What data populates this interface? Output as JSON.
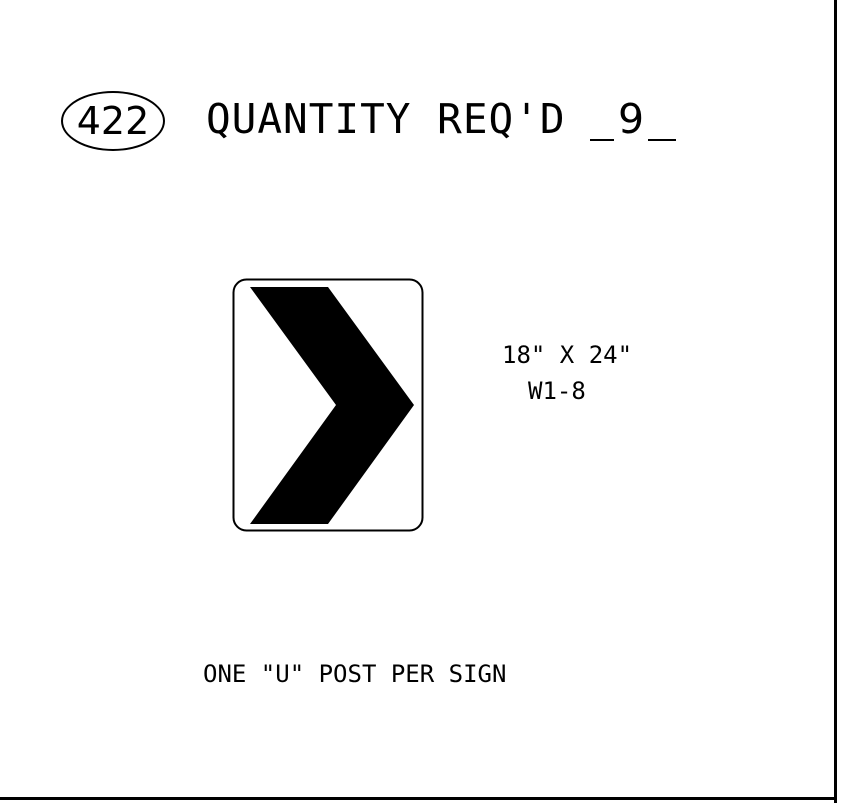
{
  "sheet": {
    "item_number": "422",
    "quantity_label": "QUANTITY REQ'D",
    "quantity_value": "9"
  },
  "sign": {
    "symbol": "chevron-right-icon",
    "size_text": "18\" X 24\"",
    "code": "W1-8",
    "background_color": "#ffffff",
    "symbol_color": "#000000"
  },
  "notes": {
    "post_note": "ONE \"U\" POST PER SIGN"
  }
}
